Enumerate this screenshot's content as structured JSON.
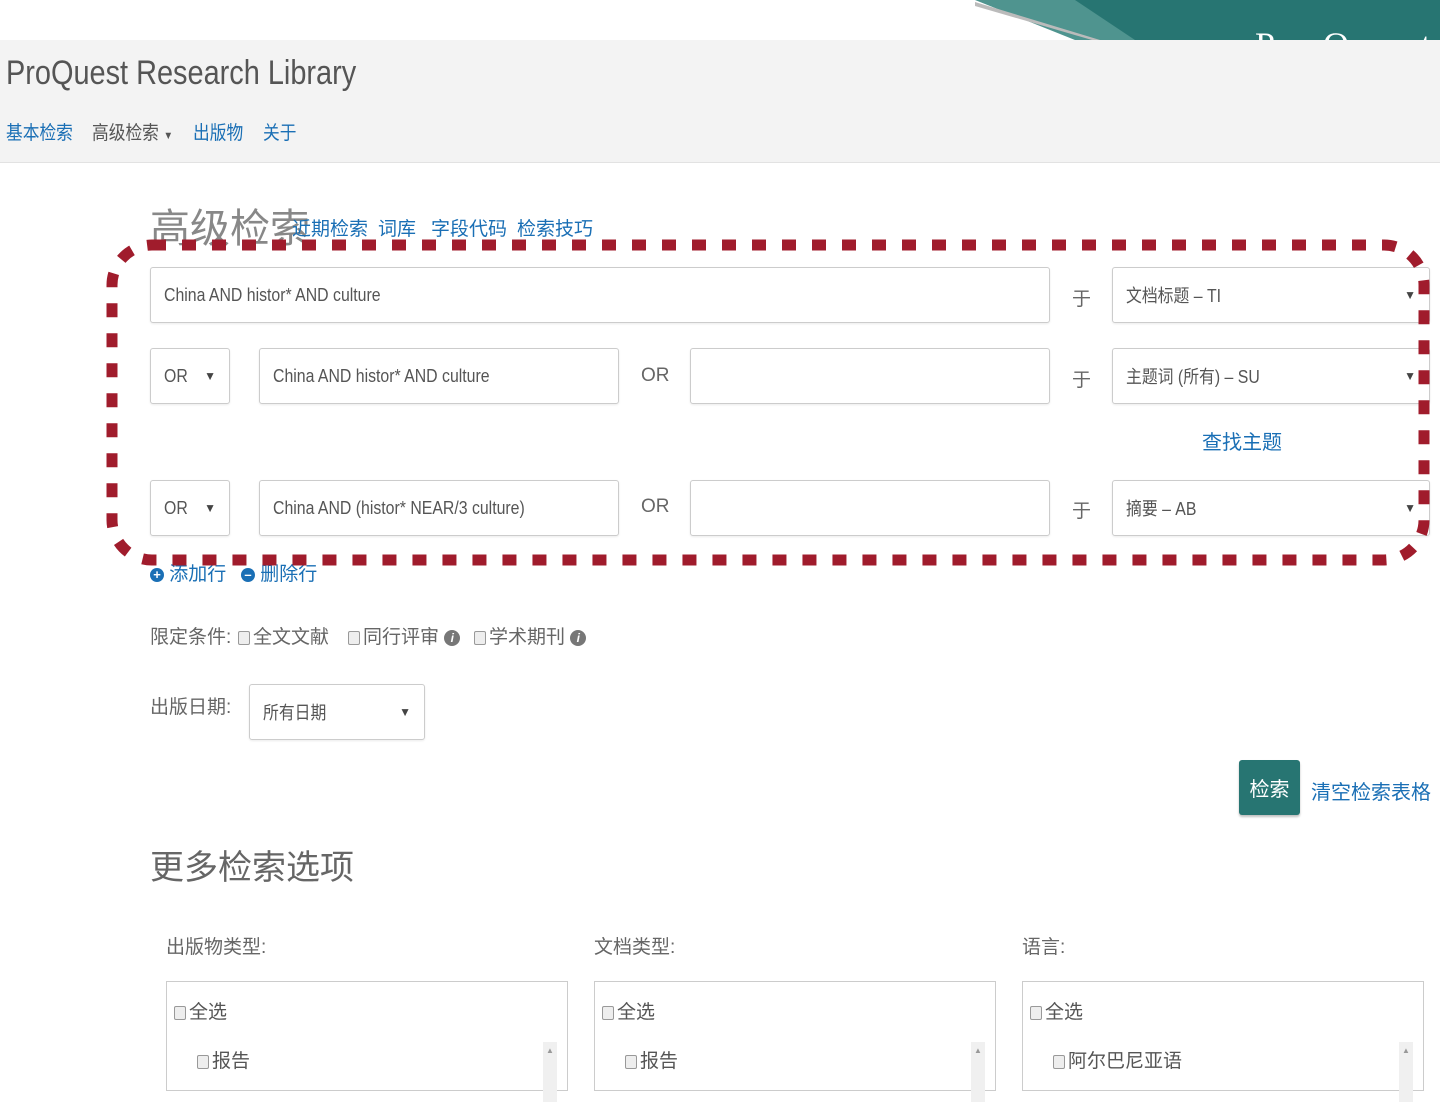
{
  "brand": {
    "logo_text": "ProQuest",
    "teal": "#277572",
    "accent_red": "#a01c2c",
    "link_blue": "#1a6fb5"
  },
  "header": {
    "title": "ProQuest Research Library",
    "nav": [
      "基本检索",
      "高级检索",
      "出版物",
      "关于"
    ]
  },
  "advanced": {
    "title": "高级检索",
    "links": [
      "近期检索",
      "词库",
      "字段代码",
      "检索技巧"
    ]
  },
  "rows": [
    {
      "query": "China AND histor* AND culture",
      "in_label": "于",
      "field": "文档标题 – TI"
    },
    {
      "operator": "OR",
      "query": "China AND histor* AND culture",
      "or_label": "OR",
      "query2": "",
      "in_label": "于",
      "field": "主题词 (所有) – SU",
      "extra_link": "查找主题"
    },
    {
      "operator": "OR",
      "query": "China AND (histor* NEAR/3 culture)",
      "or_label": "OR",
      "query2": "",
      "in_label": "于",
      "field": "摘要 – AB"
    }
  ],
  "row_actions": {
    "add": "添加行",
    "remove": "删除行"
  },
  "limits": {
    "label": "限定条件:",
    "options": [
      "全文文献",
      "同行评审",
      "学术期刊"
    ]
  },
  "date": {
    "label": "出版日期:",
    "value": "所有日期"
  },
  "actions": {
    "search": "检索",
    "clear": "清空检索表格"
  },
  "more": {
    "title": "更多检索选项",
    "columns": [
      {
        "label": "出版物类型:",
        "select_all": "全选",
        "items": [
          "报告"
        ]
      },
      {
        "label": "文档类型:",
        "select_all": "全选",
        "items": [
          "报告"
        ]
      },
      {
        "label": "语言:",
        "select_all": "全选",
        "items": [
          "阿尔巴尼亚语"
        ]
      }
    ]
  }
}
